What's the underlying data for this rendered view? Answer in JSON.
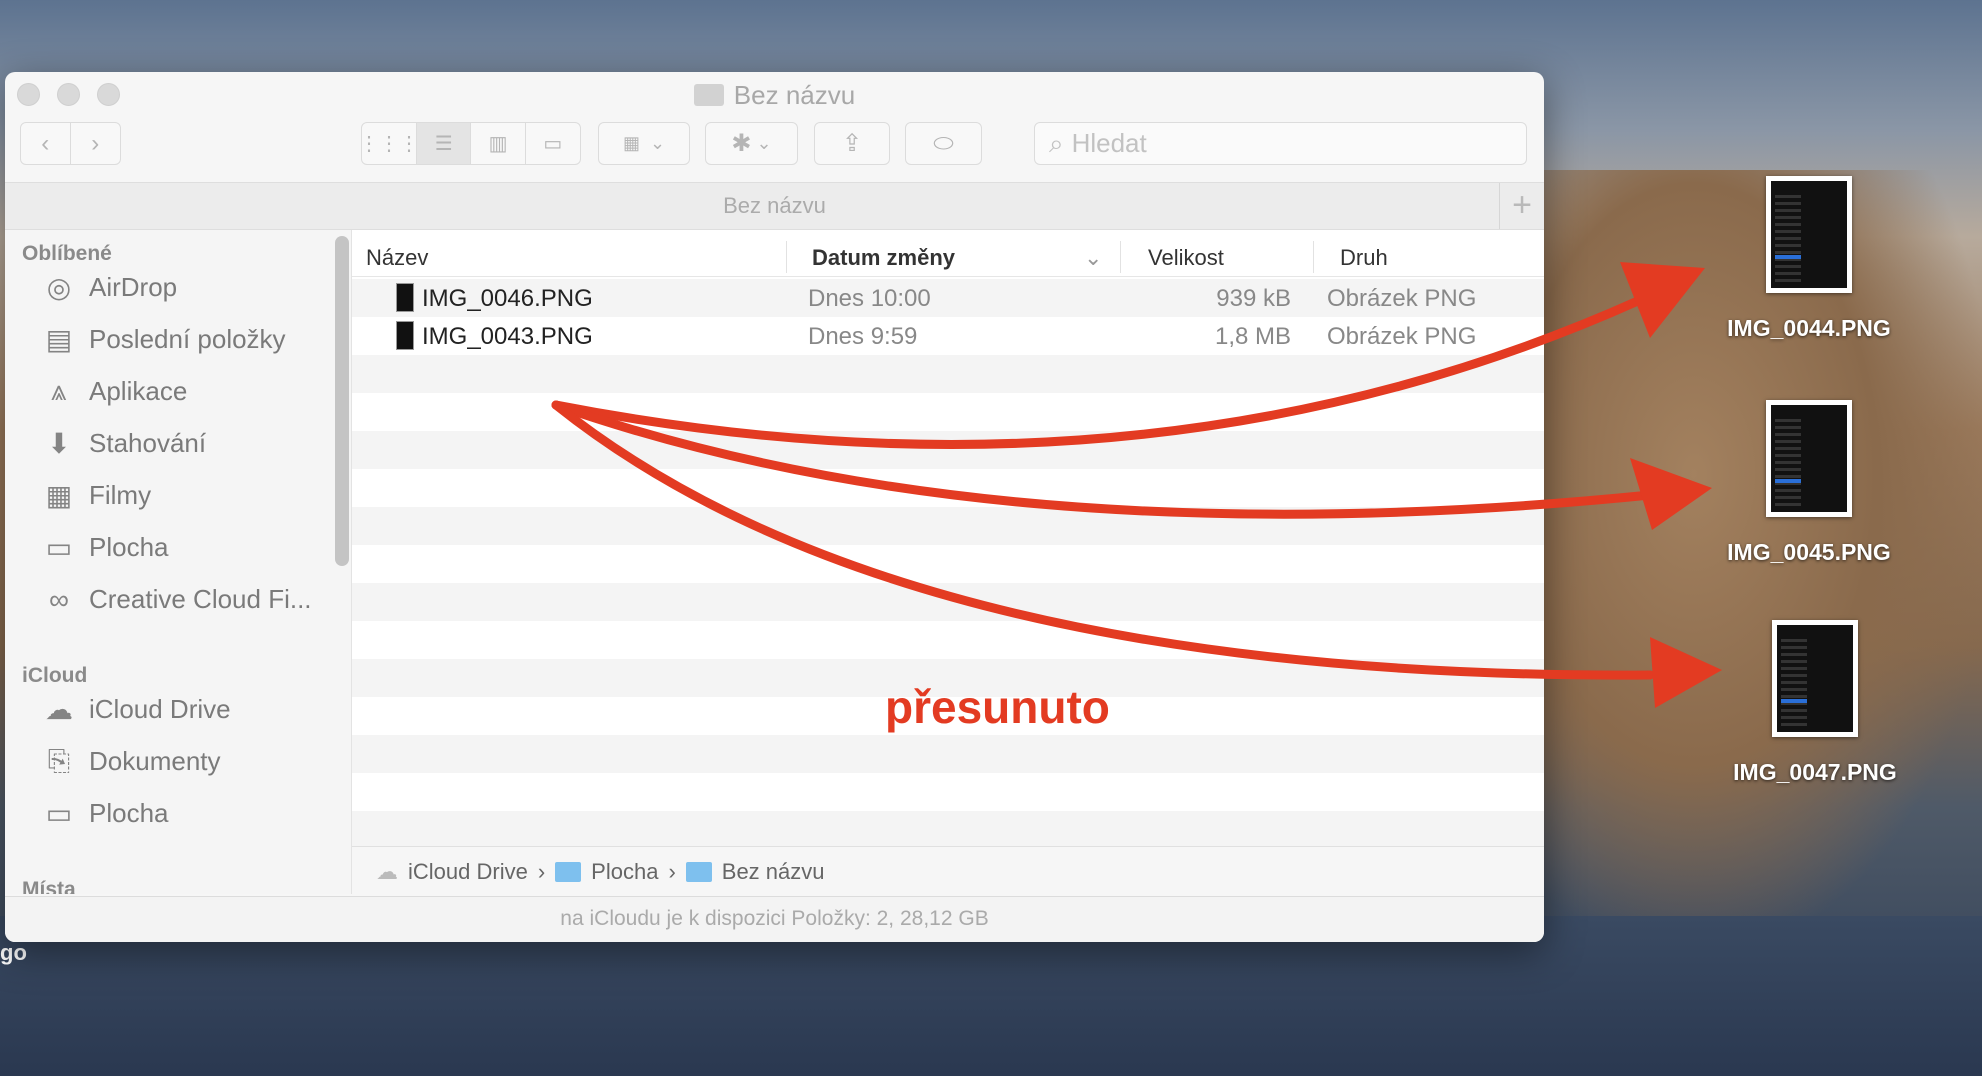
{
  "window": {
    "title": "Bez názvu",
    "tab_title": "Bez názvu"
  },
  "toolbar": {
    "search_placeholder": "Hledat"
  },
  "sidebar": {
    "sections": [
      {
        "header": "Oblíbené",
        "items": [
          {
            "label": "AirDrop",
            "icon": "airdrop-icon"
          },
          {
            "label": "Poslední položky",
            "icon": "recents-icon"
          },
          {
            "label": "Aplikace",
            "icon": "applications-icon"
          },
          {
            "label": "Stahování",
            "icon": "downloads-icon"
          },
          {
            "label": "Filmy",
            "icon": "movies-icon"
          },
          {
            "label": "Plocha",
            "icon": "desktop-icon"
          },
          {
            "label": "Creative Cloud Fi...",
            "icon": "creative-cloud-icon"
          }
        ]
      },
      {
        "header": "iCloud",
        "items": [
          {
            "label": "iCloud Drive",
            "icon": "cloud-icon"
          },
          {
            "label": "Dokumenty",
            "icon": "documents-icon"
          },
          {
            "label": "Plocha",
            "icon": "desktop-icon"
          }
        ]
      },
      {
        "header": "Místa",
        "items": []
      }
    ]
  },
  "columns": {
    "name": "Název",
    "date": "Datum změny",
    "size": "Velikost",
    "kind": "Druh"
  },
  "files": [
    {
      "name": "IMG_0046.PNG",
      "date": "Dnes 10:00",
      "size": "939 kB",
      "kind": "Obrázek PNG"
    },
    {
      "name": "IMG_0043.PNG",
      "date": "Dnes 9:59",
      "size": "1,8 MB",
      "kind": "Obrázek PNG"
    }
  ],
  "path": [
    "iCloud Drive",
    "Plocha",
    "Bez názvu"
  ],
  "status": "na iCloudu je k dispozici Položky: 2, 28,12 GB",
  "desktop": {
    "icons": [
      "IMG_0044.PNG",
      "IMG_0045.PNG",
      "IMG_0047.PNG"
    ],
    "partial_label": "go"
  },
  "annotation": {
    "text": "přesunuto",
    "color": "#e33b22"
  }
}
